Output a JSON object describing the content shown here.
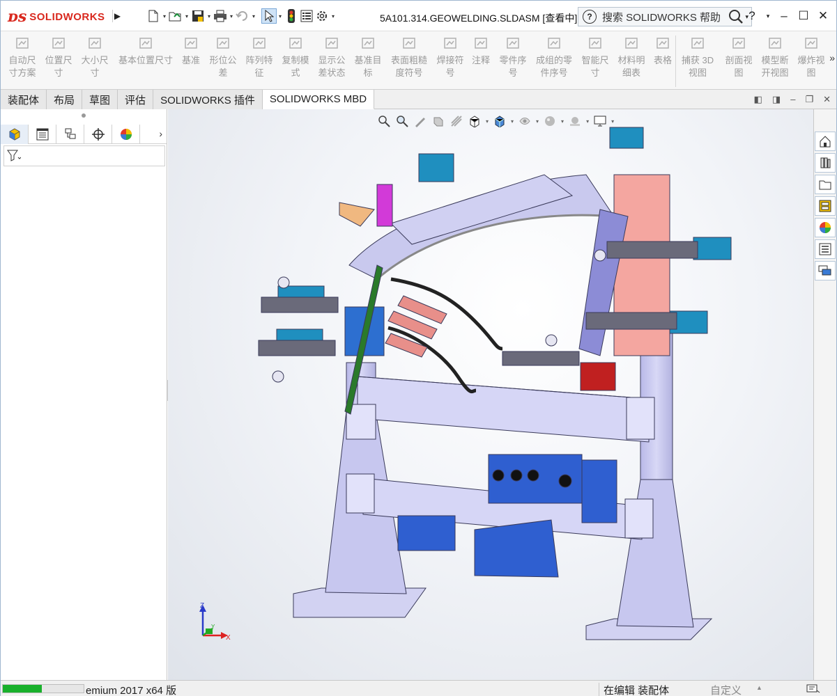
{
  "app": {
    "logo_text": "SOLIDWORKS",
    "document_title": "5A101.314.GEOWELDING.SLDASM [查看中]",
    "search_placeholder": "搜索 SOLIDWORKS 帮助",
    "window_controls": [
      "?",
      "–",
      "☐",
      "✕"
    ]
  },
  "quick_access": [
    {
      "name": "new-icon"
    },
    {
      "name": "open-icon"
    },
    {
      "name": "save-icon"
    },
    {
      "name": "print-icon"
    },
    {
      "name": "undo-icon"
    },
    {
      "name": "select-icon"
    },
    {
      "name": "rebuild-icon"
    },
    {
      "name": "file-properties-icon"
    },
    {
      "name": "options-icon"
    }
  ],
  "ribbon": {
    "items": [
      {
        "line1": "自动尺",
        "line2": "寸方案",
        "icon": "auto-dimension-icon"
      },
      {
        "line1": "位置尺",
        "line2": "寸",
        "icon": "location-dimension-icon"
      },
      {
        "line1": "大小尺",
        "line2": "寸",
        "icon": "size-dimension-icon"
      },
      {
        "line1": "基本位置尺寸",
        "line2": "",
        "icon": "basic-location-dimension-icon"
      },
      {
        "line1": "基准",
        "line2": "",
        "icon": "datum-icon"
      },
      {
        "line1": "形位公",
        "line2": "差",
        "icon": "geometric-tolerance-icon"
      },
      {
        "line1": "阵列特",
        "line2": "征",
        "icon": "pattern-feature-icon"
      },
      {
        "line1": "复制模",
        "line2": "式",
        "icon": "copy-scheme-icon"
      },
      {
        "line1": "显示公",
        "line2": "差状态",
        "icon": "tolerance-status-icon"
      },
      {
        "line1": "基准目",
        "line2": "标",
        "icon": "datum-target-icon"
      },
      {
        "line1": "表面粗糙",
        "line2": "度符号",
        "icon": "surface-finish-icon"
      },
      {
        "line1": "焊接符",
        "line2": "号",
        "icon": "weld-symbol-icon"
      },
      {
        "line1": "注释",
        "line2": "",
        "icon": "note-icon"
      },
      {
        "line1": "零件序",
        "line2": "号",
        "icon": "balloon-icon"
      },
      {
        "line1": "成组的零",
        "line2": "件序号",
        "icon": "stacked-balloon-icon"
      },
      {
        "line1": "智能尺",
        "line2": "寸",
        "icon": "smart-dimension-icon"
      },
      {
        "line1": "材料明",
        "line2": "细表",
        "icon": "bill-of-materials-icon"
      },
      {
        "line1": "表格",
        "line2": "",
        "icon": "table-icon"
      },
      {
        "line1": "捕获 3D",
        "line2": "视图",
        "icon": "capture-3d-view-icon"
      },
      {
        "line1": "剖面视",
        "line2": "图",
        "icon": "section-view-icon"
      },
      {
        "line1": "模型断",
        "line2": "开视图",
        "icon": "model-break-view-icon"
      },
      {
        "line1": "爆炸视",
        "line2": "图",
        "icon": "exploded-view-icon"
      }
    ],
    "more": "»"
  },
  "tabs": [
    {
      "label": "装配体",
      "active": false
    },
    {
      "label": "布局",
      "active": false
    },
    {
      "label": "草图",
      "active": false
    },
    {
      "label": "评估",
      "active": false
    },
    {
      "label": "SOLIDWORKS 插件",
      "active": false
    },
    {
      "label": "SOLIDWORKS MBD",
      "active": true
    }
  ],
  "left_panel": {
    "tabs": [
      "feature-manager-icon",
      "property-manager-icon",
      "configuration-manager-icon",
      "dimxpert-manager-icon",
      "display-manager-icon"
    ],
    "arrow": "›"
  },
  "task_pane": [
    "home-icon",
    "design-library-icon",
    "file-explorer-icon",
    "view-palette-icon",
    "appearances-icon",
    "custom-properties-icon",
    "forum-icon"
  ],
  "triad": {
    "x": "X",
    "y": "Y",
    "z": "Z"
  },
  "status": {
    "progress": 0.48,
    "text": "emium 2017 x64 版",
    "mode": "在编辑 装配体",
    "units": "自定义"
  },
  "colors": {
    "frame": "#c9c9ee",
    "frame_edge": "#3a3a5a",
    "clamp_blue": "#2d6fd0",
    "cylinder_teal": "#1f8fbf",
    "pink_block": "#f4a6a0",
    "accent_red": "#d9281e"
  }
}
